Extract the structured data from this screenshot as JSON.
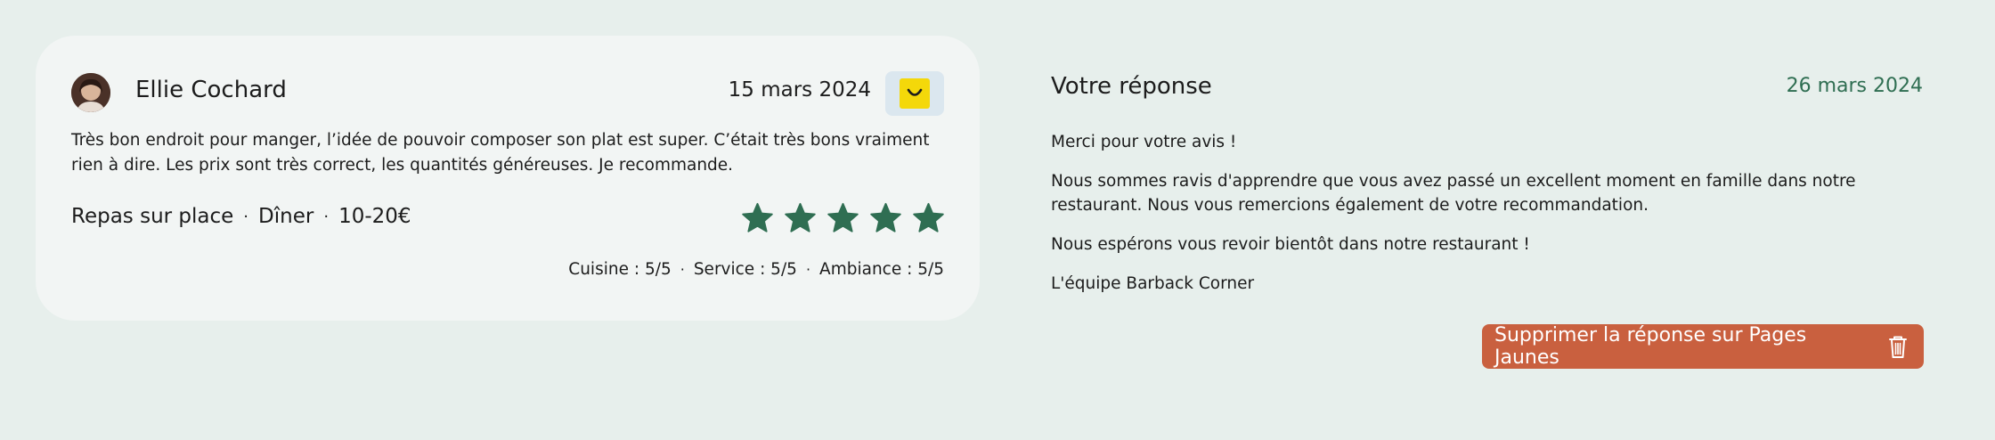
{
  "review": {
    "author": "Ellie Cochard",
    "date": "15 mars 2024",
    "source_icon": "pages-jaunes-logo-icon",
    "text": "Très bon endroit pour manger, l’idée de pouvoir composer son plat est super. C’était très bons vraiment rien à dire. Les prix sont très correct, les quantités généreuses. Je recommande.",
    "meta": [
      "Repas sur place",
      "Dîner",
      "10-20€"
    ],
    "rating": 5,
    "rating_max": 5,
    "scores": [
      "Cuisine : 5/5",
      "Service : 5/5",
      "Ambiance : 5/5"
    ]
  },
  "response": {
    "title": "Votre réponse",
    "date": "26 mars 2024",
    "paragraphs": [
      "Merci pour votre avis !",
      "Nous sommes ravis d'apprendre que vous avez passé un excellent moment en famille dans notre restaurant. Nous vous remercions également de votre recommandation.",
      "Nous espérons vous revoir bientôt dans notre restaurant !",
      "L'équipe Barback Corner"
    ],
    "delete_label": "Supprimer la réponse sur Pages Jaunes",
    "delete_icon": "trash-icon"
  },
  "colors": {
    "background": "#e7efec",
    "card": "#f2f5f4",
    "star": "#2f6e52",
    "accent_date": "#2f6e52",
    "delete_button": "#c9603f",
    "source_badge": "#dbe7ef",
    "source_logo": "#f4d80a"
  }
}
